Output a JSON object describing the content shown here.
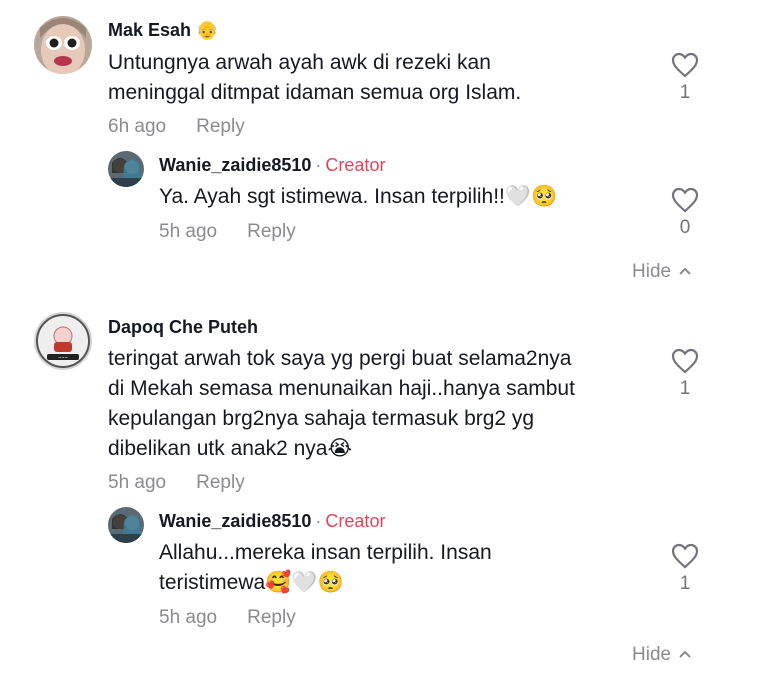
{
  "comments": [
    {
      "username": "Mak Esah",
      "badge": "👴",
      "text_lines": [
        "Untungnya arwah ayah awk di rezeki kan",
        "meninggal ditmpat idaman semua org Islam."
      ],
      "time": "6h ago",
      "reply_label": "Reply",
      "likes": "1",
      "replies": [
        {
          "username": "Wanie_zaidie8510",
          "tag": "Creator",
          "text_lines": [
            "Ya. Ayah sgt istimewa. Insan terpilih!!🤍🥺"
          ],
          "time": "5h ago",
          "reply_label": "Reply",
          "likes": "0"
        }
      ],
      "hide_label": "Hide"
    },
    {
      "username": "Dapoq Che Puteh",
      "text_lines": [
        "teringat arwah tok saya yg pergi buat selama2nya",
        "di Mekah semasa menunaikan haji..hanya sambut",
        "kepulangan brg2nya sahaja termasuk brg2 yg",
        "dibelikan utk anak2 nya😭"
      ],
      "time": "5h ago",
      "reply_label": "Reply",
      "likes": "1",
      "replies": [
        {
          "username": "Wanie_zaidie8510",
          "tag": "Creator",
          "text_lines": [
            "Allahu...mereka insan terpilih. Insan",
            "teristimewa🥰🤍🥺"
          ],
          "time": "5h ago",
          "reply_label": "Reply",
          "likes": "1"
        }
      ],
      "hide_label": "Hide"
    }
  ],
  "colors": {
    "text": "#161823",
    "muted": "#8a8b91",
    "creator": "#e0455c"
  },
  "icons": {
    "like": "heart-outline-icon",
    "hide": "chevron-up-icon"
  }
}
